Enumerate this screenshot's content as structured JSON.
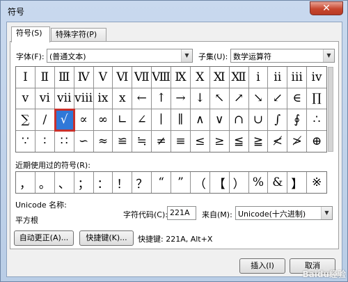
{
  "window": {
    "title": "符号",
    "close_label": "✕"
  },
  "tabs": [
    "符号(S)",
    "特殊字符(P)"
  ],
  "font": {
    "label": "字体(F):",
    "value": "(普通文本)"
  },
  "subset": {
    "label": "子集(U):",
    "value": "数学运算符"
  },
  "symbols": [
    [
      "Ⅰ",
      "Ⅱ",
      "Ⅲ",
      "Ⅳ",
      "Ⅴ",
      "Ⅵ",
      "Ⅶ",
      "Ⅷ",
      "Ⅸ",
      "Ⅹ",
      "Ⅺ",
      "Ⅻ",
      "ⅰ",
      "ⅱ",
      "ⅲ",
      "ⅳ"
    ],
    [
      "ⅴ",
      "ⅵ",
      "ⅶ",
      "ⅷ",
      "ⅸ",
      "ⅹ",
      "←",
      "↑",
      "→",
      "↓",
      "↖",
      "↗",
      "↘",
      "↙",
      "∈",
      "∏"
    ],
    [
      "∑",
      "∕",
      "√",
      "∝",
      "∞",
      "∟",
      "∠",
      "∣",
      "∥",
      "∧",
      "∨",
      "∩",
      "∪",
      "∫",
      "∮",
      "∴"
    ],
    [
      "∵",
      "∶",
      "∷",
      "∽",
      "≈",
      "≌",
      "≒",
      "≠",
      "≡",
      "≤",
      "≥",
      "≦",
      "≧",
      "≮",
      "≯",
      "⊕"
    ]
  ],
  "selected": {
    "row": 2,
    "col": 2
  },
  "recent": {
    "label": "近期使用过的符号(R):",
    "items": [
      "，",
      "。",
      "、",
      "；",
      "：",
      "！",
      "？",
      "“",
      "”",
      "（",
      "【",
      "）",
      "%",
      "&",
      "】",
      "※"
    ]
  },
  "unicode_name": {
    "label": "Unicode 名称:",
    "value": "平方根"
  },
  "char_code": {
    "label": "字符代码(C):",
    "value": "221A"
  },
  "from": {
    "label": "来自(M):",
    "value": "Unicode(十六进制)"
  },
  "buttons": {
    "autocorrect": "自动更正(A)...",
    "shortcut_key": "快捷键(K)...",
    "shortcut_text": "快捷键: 221A, Alt+X",
    "insert": "插入(I)",
    "cancel": "取消"
  },
  "watermark": "Baidu经验"
}
